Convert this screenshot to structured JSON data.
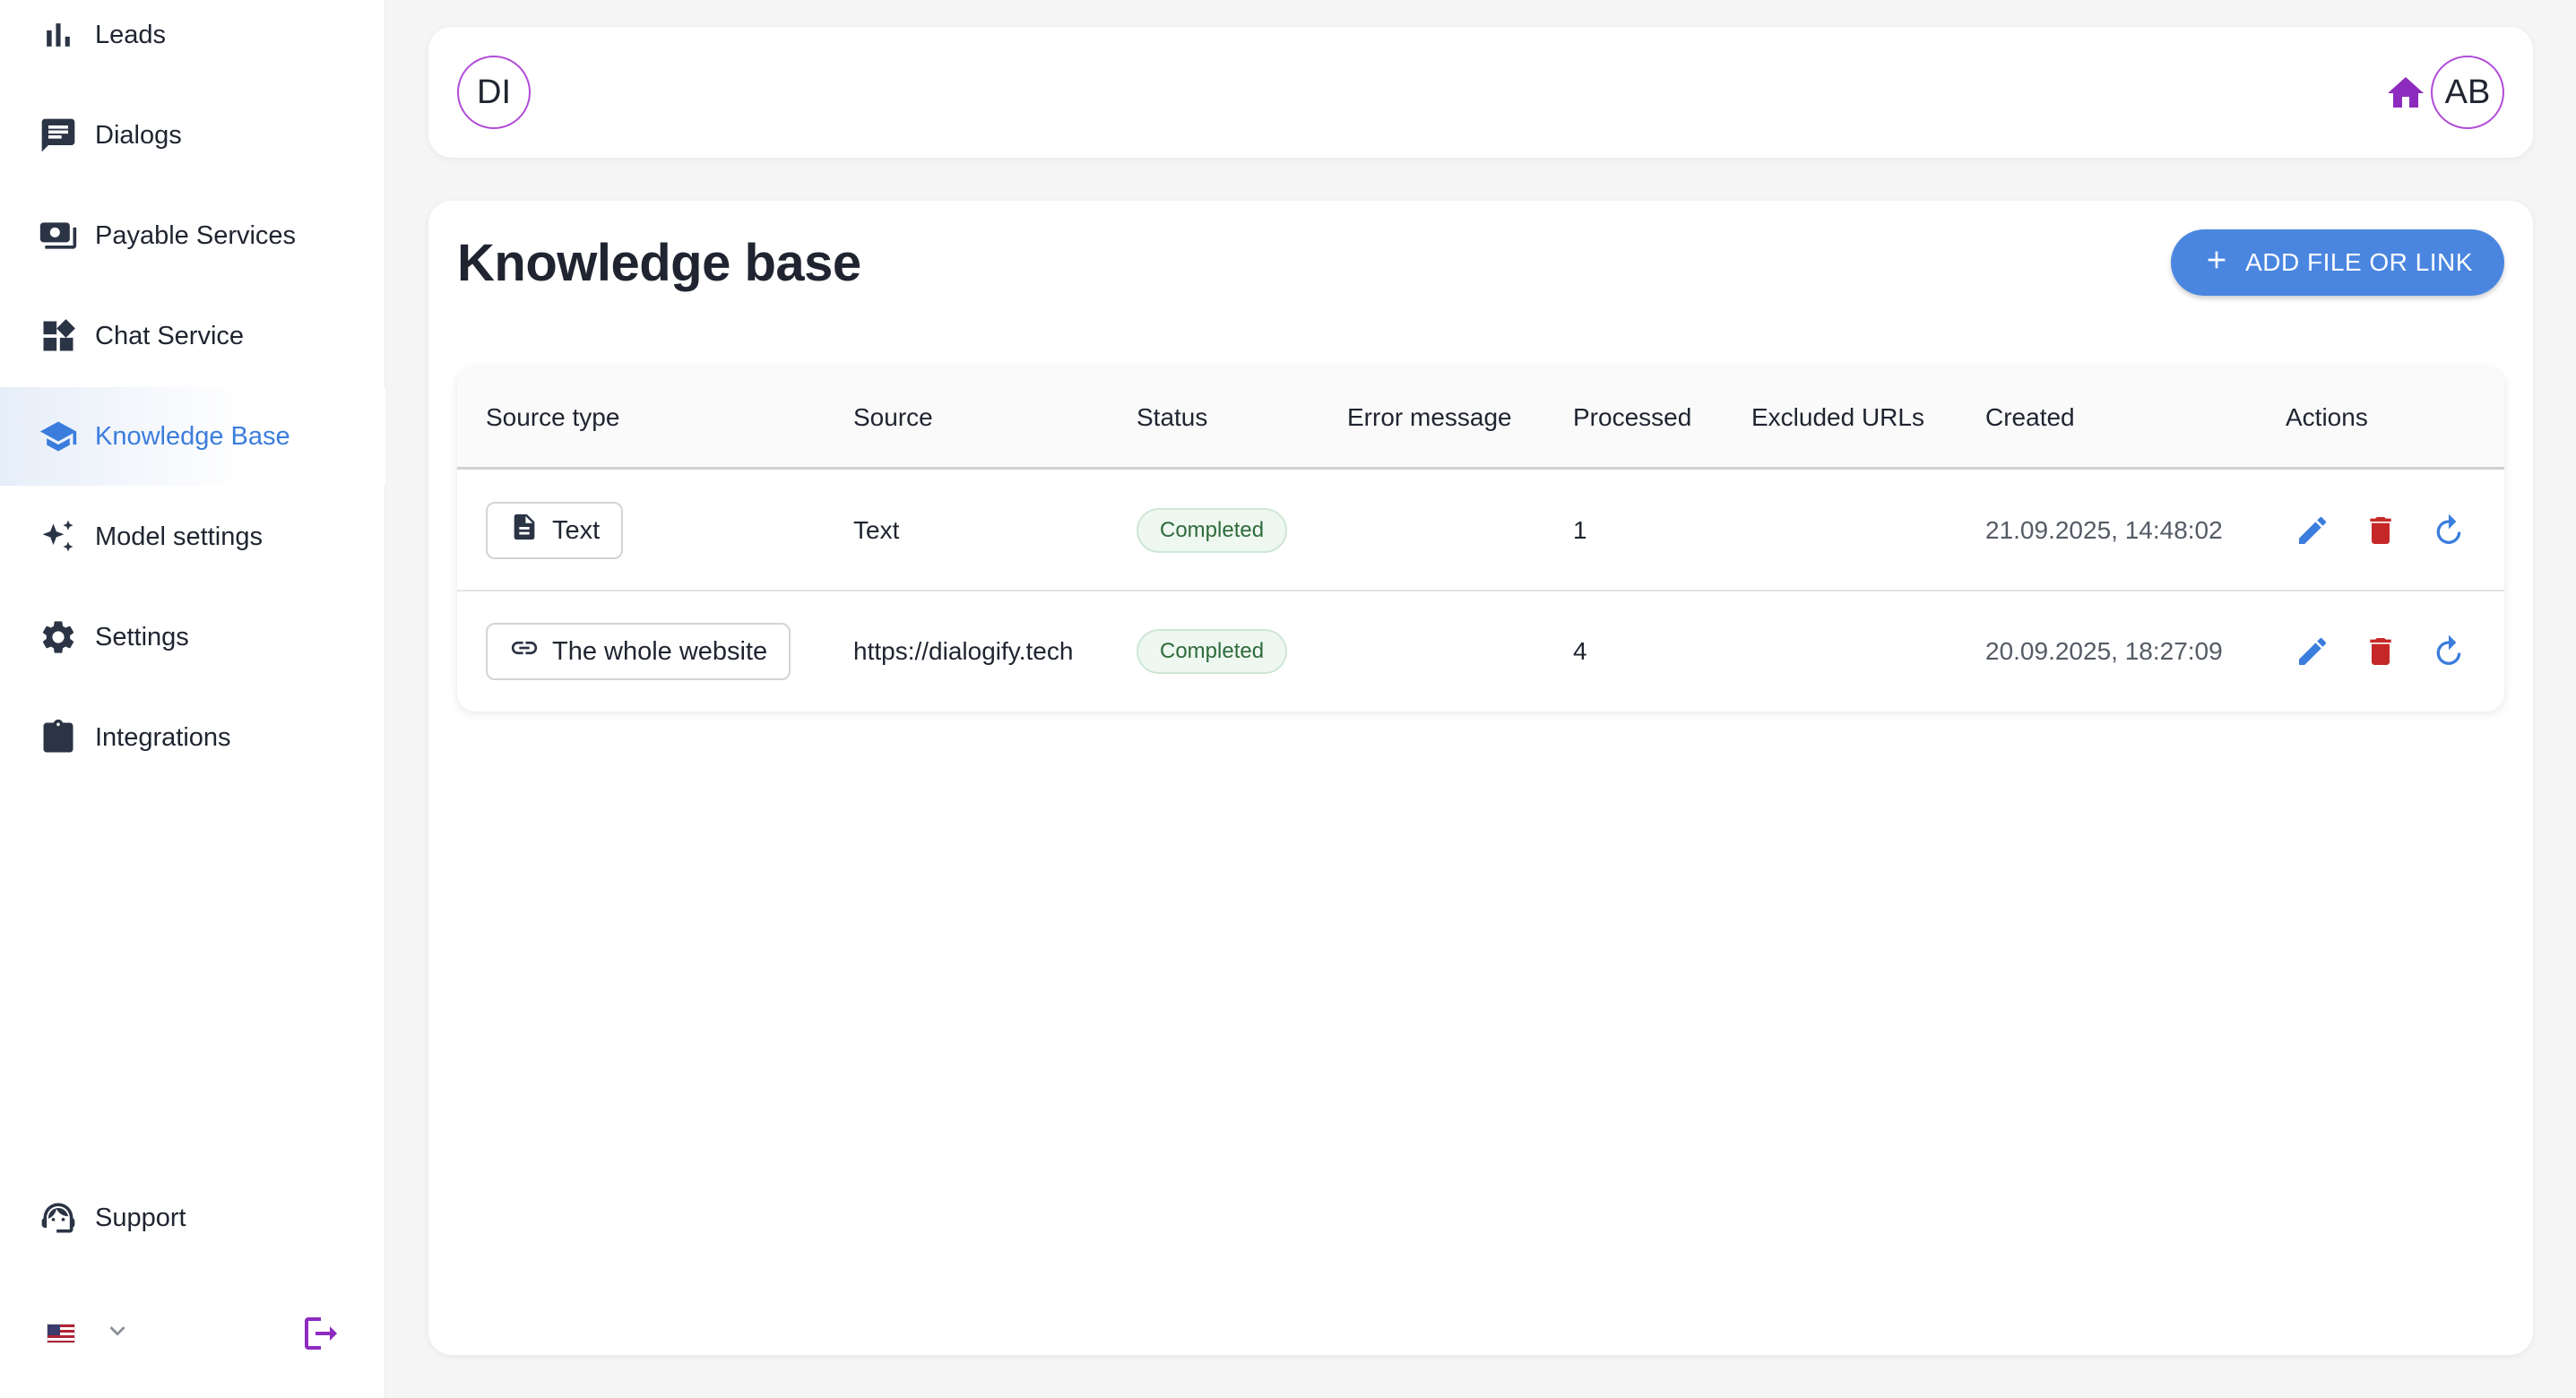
{
  "sidebar": {
    "items": [
      {
        "label": "Leads",
        "icon": "bar-chart-icon"
      },
      {
        "label": "Dialogs",
        "icon": "chat-icon"
      },
      {
        "label": "Payable Services",
        "icon": "payments-icon"
      },
      {
        "label": "Chat Service",
        "icon": "widgets-icon"
      },
      {
        "label": "Knowledge Base",
        "icon": "school-icon",
        "active": true
      },
      {
        "label": "Model settings",
        "icon": "sparkle-icon"
      },
      {
        "label": "Settings",
        "icon": "gear-icon"
      },
      {
        "label": "Integrations",
        "icon": "integration-icon"
      }
    ],
    "support": {
      "label": "Support",
      "icon": "support-agent-icon"
    },
    "language": {
      "flag": "us-flag-icon",
      "icon": "chevron-down-icon"
    },
    "logout_icon": "logout-icon"
  },
  "topbar": {
    "workspace_avatar": "DI",
    "user_avatar": "AB",
    "home_icon": "home-icon"
  },
  "main": {
    "title": "Knowledge base",
    "add_button": "ADD FILE OR LINK",
    "table": {
      "headers": [
        "Source type",
        "Source",
        "Status",
        "Error message",
        "Processed",
        "Excluded URLs",
        "Created",
        "Actions"
      ],
      "rows": [
        {
          "source_type": "Text",
          "source_type_icon": "document-icon",
          "source": "Text",
          "status": "Completed",
          "error": "",
          "processed": "1",
          "excluded": "",
          "created": "21.09.2025, 14:48:02"
        },
        {
          "source_type": "The whole website",
          "source_type_icon": "link-icon",
          "source": "https://dialogify.tech",
          "status": "Completed",
          "error": "",
          "processed": "4",
          "excluded": "",
          "created": "20.09.2025, 18:27:09"
        }
      ]
    }
  },
  "colors": {
    "accent": "#3b7ddd",
    "brand_purple": "#8e2bbf",
    "delete_red": "#c62828",
    "status_green": "#2e6b3a"
  }
}
